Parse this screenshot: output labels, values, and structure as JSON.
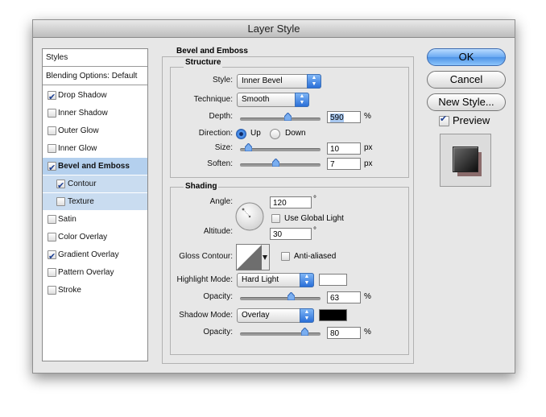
{
  "window": {
    "title": "Layer Style"
  },
  "style_list": {
    "header": "Styles",
    "blending": "Blending Options: Default",
    "items": [
      {
        "label": "Drop Shadow",
        "checked": true
      },
      {
        "label": "Inner Shadow",
        "checked": false
      },
      {
        "label": "Outer Glow",
        "checked": false
      },
      {
        "label": "Inner Glow",
        "checked": false
      },
      {
        "label": "Bevel and Emboss",
        "checked": true
      },
      {
        "label": "Contour",
        "checked": true
      },
      {
        "label": "Texture",
        "checked": false
      },
      {
        "label": "Satin",
        "checked": false
      },
      {
        "label": "Color Overlay",
        "checked": false
      },
      {
        "label": "Gradient Overlay",
        "checked": true
      },
      {
        "label": "Pattern Overlay",
        "checked": false
      },
      {
        "label": "Stroke",
        "checked": false
      }
    ]
  },
  "bevel": {
    "title": "Bevel and Emboss",
    "structure": {
      "title": "Structure",
      "style_label": "Style:",
      "style_value": "Inner Bevel",
      "technique_label": "Technique:",
      "technique_value": "Smooth",
      "depth_label": "Depth:",
      "depth_value": "590",
      "depth_unit": "%",
      "depth_level": 0.59,
      "direction_label": "Direction:",
      "direction_up": "Up",
      "direction_down": "Down",
      "direction_selected": "Up",
      "size_label": "Size:",
      "size_value": "10",
      "size_unit": "px",
      "size_level": 0.1,
      "soften_label": "Soften:",
      "soften_value": "7",
      "soften_unit": "px",
      "soften_level": 0.44
    },
    "shading": {
      "title": "Shading",
      "angle_label": "Angle:",
      "angle_value": "120",
      "angle_unit": "°",
      "global_light_label": "Use Global Light",
      "global_light_checked": false,
      "altitude_label": "Altitude:",
      "altitude_value": "30",
      "altitude_unit": "°",
      "gloss_label": "Gloss Contour:",
      "anti_aliased_label": "Anti-aliased",
      "anti_aliased_checked": false,
      "highlight_mode_label": "Highlight Mode:",
      "highlight_mode_value": "Hard Light",
      "highlight_color": "#ffffff",
      "highlight_opacity_label": "Opacity:",
      "highlight_opacity_value": "63",
      "highlight_opacity_unit": "%",
      "highlight_opacity_level": 0.63,
      "shadow_mode_label": "Shadow Mode:",
      "shadow_mode_value": "Overlay",
      "shadow_color": "#000000",
      "shadow_opacity_label": "Opacity:",
      "shadow_opacity_value": "80",
      "shadow_opacity_unit": "%",
      "shadow_opacity_level": 0.8
    }
  },
  "buttons": {
    "ok": "OK",
    "cancel": "Cancel",
    "new_style": "New Style..."
  },
  "preview": {
    "label": "Preview",
    "checked": true
  },
  "colors": {
    "selection": "#b4d0ee",
    "accent": "#4e93e6"
  }
}
